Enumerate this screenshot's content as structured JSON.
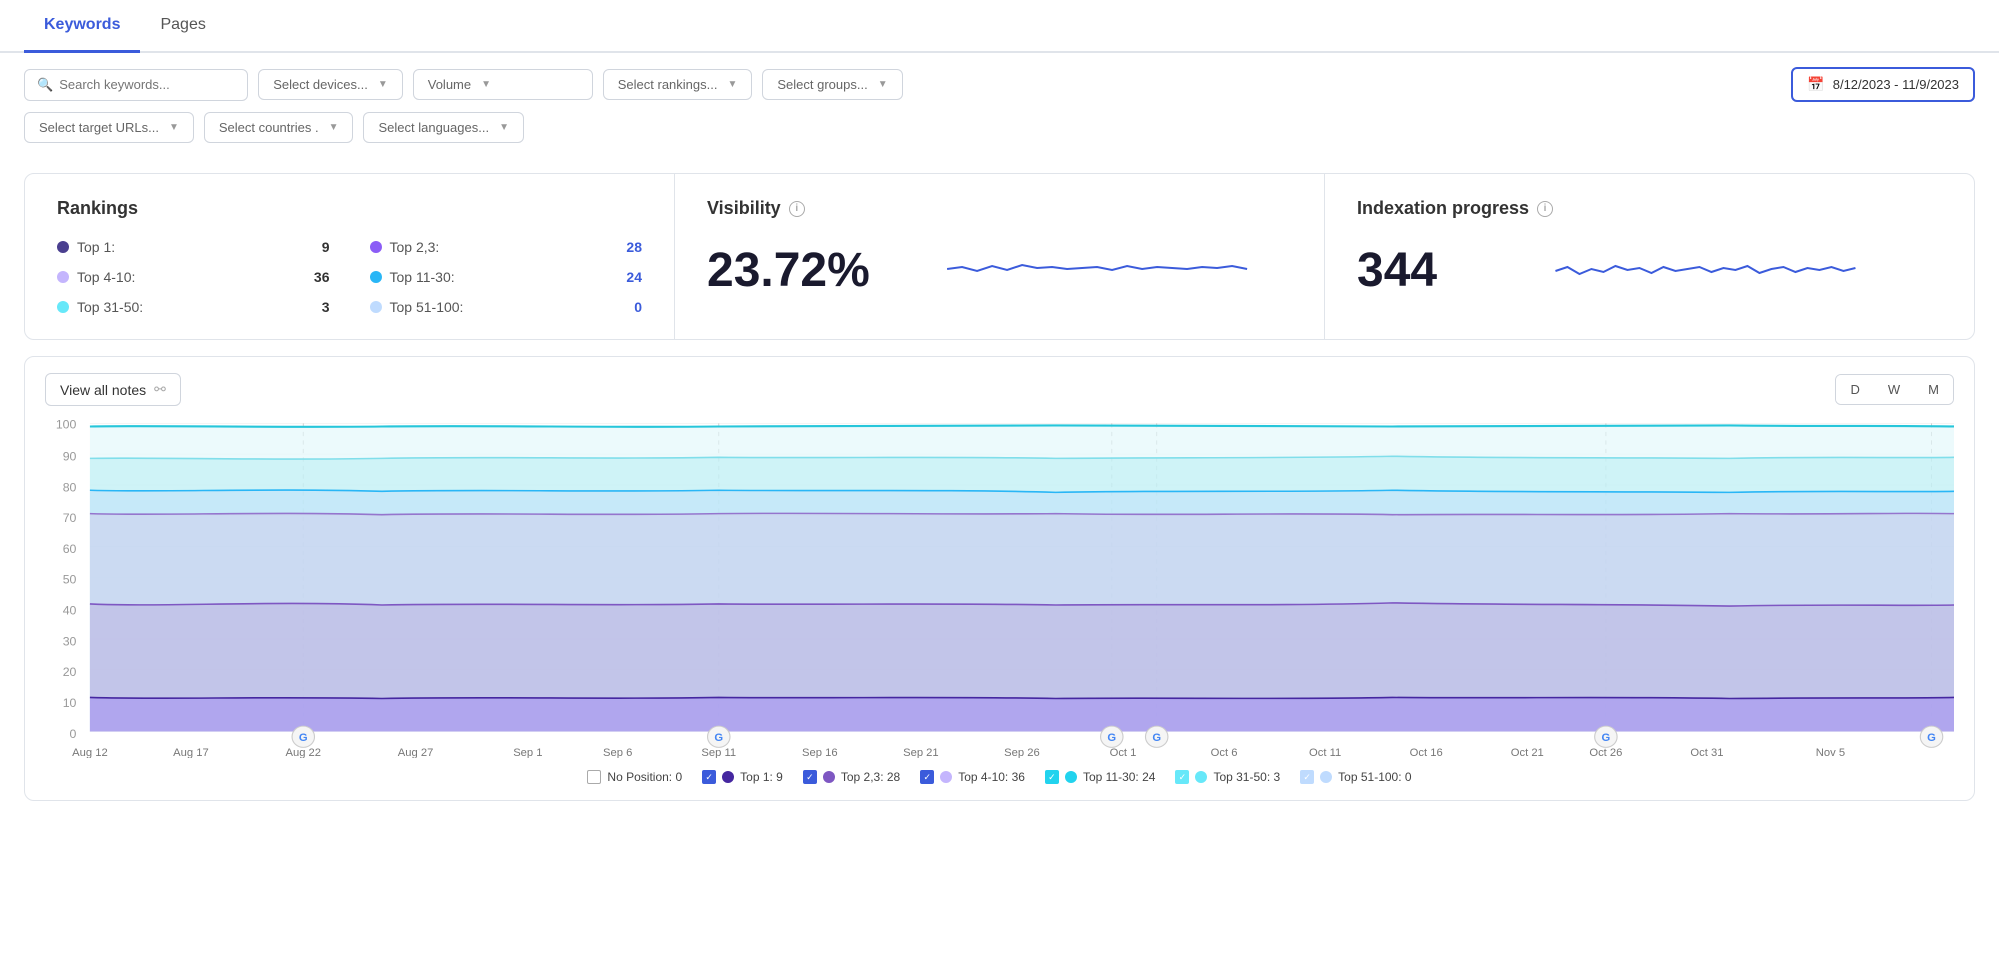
{
  "tabs": [
    {
      "id": "keywords",
      "label": "Keywords",
      "active": true
    },
    {
      "id": "pages",
      "label": "Pages",
      "active": false
    }
  ],
  "filters": {
    "search_placeholder": "Search keywords...",
    "devices_placeholder": "Select devices...",
    "volume_placeholder": "Volume",
    "rankings_placeholder": "Select rankings...",
    "groups_placeholder": "Select groups...",
    "target_urls_placeholder": "Select target URLs...",
    "countries_placeholder": "Select countries .",
    "languages_placeholder": "Select languages...",
    "date_range": "8/12/2023 - 11/9/2023"
  },
  "rankings": {
    "title": "Rankings",
    "items_col1": [
      {
        "label": "Top 1:",
        "value": "9",
        "color": "#4a3f8f",
        "value_bold": false
      },
      {
        "label": "Top 4-10:",
        "value": "36",
        "color": "#b39ddb",
        "value_bold": true
      },
      {
        "label": "Top 31-50:",
        "value": "3",
        "color": "#80deea",
        "value_bold": false
      }
    ],
    "items_col2": [
      {
        "label": "Top 2,3:",
        "value": "28",
        "color": "#7c5cbf",
        "value_bold": false,
        "blue": true
      },
      {
        "label": "Top 11-30:",
        "value": "24",
        "color": "#29b6f6",
        "value_bold": false,
        "blue": true
      },
      {
        "label": "Top 51-100:",
        "value": "0",
        "color": "#b3e5fc",
        "value_bold": false,
        "blue": true
      }
    ]
  },
  "visibility": {
    "title": "Visibility",
    "value": "23.72%"
  },
  "indexation": {
    "title": "Indexation progress",
    "value": "344"
  },
  "chart": {
    "view_all_notes_label": "View all notes",
    "period_buttons": [
      {
        "label": "D",
        "active": false
      },
      {
        "label": "W",
        "active": false
      },
      {
        "label": "M",
        "active": false
      }
    ],
    "y_axis": [
      100,
      90,
      80,
      70,
      60,
      50,
      40,
      30,
      20,
      10,
      0
    ],
    "x_axis": [
      "Aug 12",
      "Aug 17",
      "Aug 22",
      "Aug 27",
      "Sep 1",
      "Sep 6",
      "Sep 11",
      "Sep 16",
      "Sep 21",
      "Sep 26",
      "Oct 1",
      "Oct 6",
      "Oct 11",
      "Oct 16",
      "Oct 21",
      "Oct 26",
      "Oct 31",
      "Nov 5"
    ],
    "google_markers": [
      "Aug 22",
      "Sep 11",
      "Oct 1",
      "Oct 6",
      "Oct 31",
      "Nov 5"
    ],
    "legend": [
      {
        "label": "No Position: 0",
        "color": null,
        "checked": false
      },
      {
        "label": "Top 1: 9",
        "color": "#3d2f8e",
        "checked": true
      },
      {
        "label": "Top 2,3: 28",
        "color": "#8b5cf6",
        "checked": true
      },
      {
        "label": "Top 4-10: 36",
        "color": "#c4b5fd",
        "checked": true
      },
      {
        "label": "Top 11-30: 24",
        "color": "#22d3ee",
        "checked": true
      },
      {
        "label": "Top 31-50: 3",
        "color": "#67e8f9",
        "checked": true
      },
      {
        "label": "Top 51-100: 0",
        "color": "#bfdbfe",
        "checked": true
      }
    ]
  }
}
